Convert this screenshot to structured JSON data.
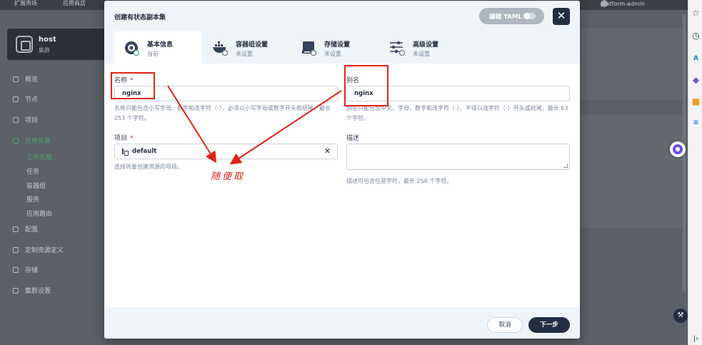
{
  "background_app": {
    "top_items": [
      "扩展市场",
      "应用商店"
    ],
    "user": "platform-admin",
    "cluster": {
      "name": "host",
      "label": "集群"
    },
    "nav": [
      {
        "label": "概览",
        "active": false
      },
      {
        "label": "节点",
        "active": false
      },
      {
        "label": "项目",
        "active": false
      },
      {
        "label": "应用负载",
        "active": true
      },
      {
        "label": "配置",
        "active": false
      },
      {
        "label": "定制资源定义",
        "active": false
      },
      {
        "label": "存储",
        "active": false
      },
      {
        "label": "集群设置",
        "active": false
      }
    ],
    "nav_sub": [
      {
        "label": "工作负载",
        "active": true
      },
      {
        "label": "任务",
        "active": false
      },
      {
        "label": "容器组",
        "active": false
      },
      {
        "label": "服务",
        "active": false
      },
      {
        "label": "应用路由",
        "active": false
      }
    ]
  },
  "modal": {
    "title": "创建有状态副本集",
    "yaml_label": "编辑 YAML",
    "close_icon": "close-icon",
    "steps": [
      {
        "title": "基本信息",
        "sub": "当前",
        "icon": "info-disc-icon",
        "active": true
      },
      {
        "title": "容器组设置",
        "sub": "未设置",
        "icon": "container-whale-icon",
        "active": false
      },
      {
        "title": "存储设置",
        "sub": "未设置",
        "icon": "disk-icon",
        "active": false
      },
      {
        "title": "高级设置",
        "sub": "未设置",
        "icon": "sliders-icon",
        "active": false
      }
    ],
    "form": {
      "name": {
        "label": "名称",
        "value": "nginx",
        "help": "名称只能包含小写字母、数字和连字符（-），必须以小写字母或数字开头和结尾，最长 253 个字符。"
      },
      "alias": {
        "label": "别名",
        "value": "nginx",
        "help": "别名只能包含中文、字母、数字和连字符（-），不得以连字符（-）开头或结尾，最长 63 个字符。"
      },
      "project": {
        "label": "项目",
        "value": "default",
        "help": "选择将要创建资源的项目。"
      },
      "description": {
        "label": "描述",
        "value": "",
        "help": "描述可包含任意字符，最长 256 个字符。"
      }
    },
    "footer": {
      "cancel": "取消",
      "next": "下一步"
    }
  },
  "annotation": {
    "text": "随便取",
    "color": "#e2231a"
  },
  "colors": {
    "accent_green": "#55bc8a",
    "dark": "#242e42",
    "header_bg": "#eff4f9"
  }
}
